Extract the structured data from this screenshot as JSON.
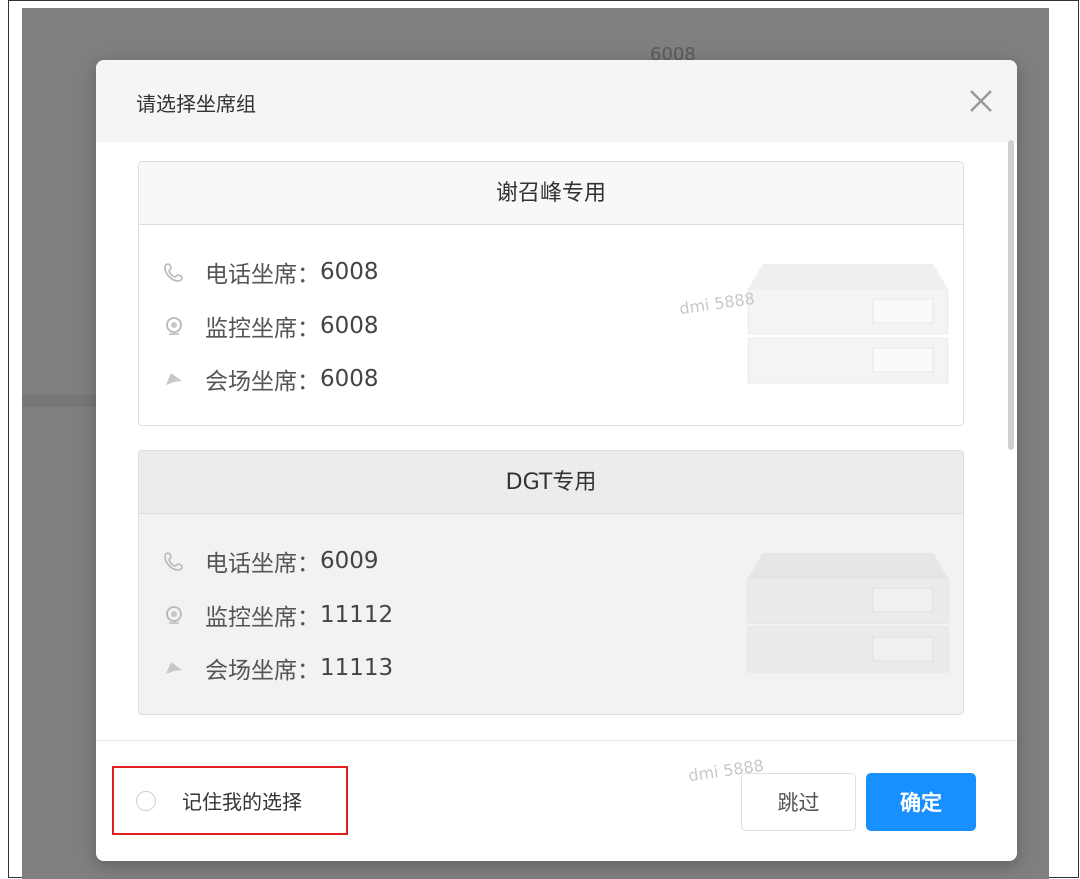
{
  "background": {
    "number_text": "6008"
  },
  "dialog": {
    "title": "请选择坐席组",
    "groups": [
      {
        "name": "谢召峰专用",
        "rows": [
          {
            "icon": "phone-icon",
            "label": "电话坐席：",
            "value": "6008"
          },
          {
            "icon": "monitor-icon",
            "label": "监控坐席：",
            "value": "6008"
          },
          {
            "icon": "conference-icon",
            "label": "会场坐席：",
            "value": "6008"
          }
        ]
      },
      {
        "name": "DGT专用",
        "rows": [
          {
            "icon": "phone-icon",
            "label": "电话坐席：",
            "value": "6009"
          },
          {
            "icon": "monitor-icon",
            "label": "监控坐席：",
            "value": "11112"
          },
          {
            "icon": "conference-icon",
            "label": "会场坐席：",
            "value": "11113"
          }
        ]
      }
    ],
    "watermark": "dmi 5888",
    "footer": {
      "remember_label": "记住我的选择",
      "skip_label": "跳过",
      "ok_label": "确定"
    }
  },
  "colors": {
    "primary": "#1890ff",
    "highlight_border": "#e02020",
    "overlay": "#7f7f7f"
  }
}
